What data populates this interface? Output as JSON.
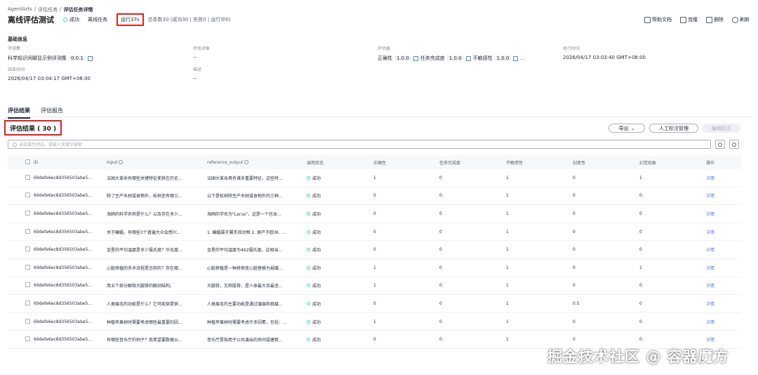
{
  "breadcrumb": [
    "AgentArts",
    "/",
    "评估任务",
    "/",
    "评估任务详情"
  ],
  "header": {
    "title": "离线评估测试",
    "status": "成功",
    "task_type": "离线任务",
    "run_time": "运行37s",
    "stats": "总条数30 (成功30 | 失败0 | 运行中0)",
    "actions": [
      {
        "label": "帮助文档",
        "icon": "book-icon"
      },
      {
        "label": "克隆",
        "icon": "copy-icon"
      },
      {
        "label": "删除",
        "icon": "trash-icon"
      },
      {
        "label": "刷新",
        "icon": "refresh-icon"
      }
    ]
  },
  "basic_info": {
    "section_title": "基础信息",
    "dataset_label": "评测集",
    "dataset_name": "科学知识闲聊显示例评测集",
    "dataset_version": "0.0.1",
    "target_label": "评估对象",
    "target_value": "--",
    "evaluator_label": "评估器",
    "evaluators": [
      {
        "name": "正确性",
        "version": "1.0.0"
      },
      {
        "name": "任务完成度",
        "version": "1.0.0"
      },
      {
        "name": "不敏感性",
        "version": "1.0.0"
      }
    ],
    "evaluator_more": "...",
    "exec_time_label": "执行时间",
    "exec_time": "2026/04/17 03:03:40 GMT+08:00",
    "end_time_label": "结束时间",
    "end_time": "2026/04/17 03:04:17 GMT+08:00",
    "desc_label": "描述",
    "desc_value": "--"
  },
  "tabs": [
    {
      "label": "评估结果",
      "active": true
    },
    {
      "label": "评估报告",
      "active": false
    }
  ],
  "results": {
    "title": "评估结果 ( 30 )",
    "export_label": "导出",
    "manual_label": "人工标注管理",
    "batch_label": "编辑标注",
    "search_placeholder": "选择属性筛选，或输入关键字搜索"
  },
  "table": {
    "columns": [
      "ID",
      "input",
      "reference_output",
      "调用状态",
      "正确性",
      "任务完成度",
      "不敏感性",
      "创意性",
      "幻觉现象",
      "操作"
    ],
    "rows": [
      {
        "id": "69defe6ec8d356503abe5...",
        "input": "法国大革命有哪些关键特征使其在历史...",
        "ref": "法国大革命具有诸多重要特征，这些特...",
        "status": "成功",
        "c1": "1",
        "c2": "0",
        "c3": "1",
        "c4": "0",
        "c5": "1",
        "op": "详情"
      },
      {
        "id": "69defe6ec8d356503abe5...",
        "input": "除了生产木材或食物外，松树还有哪三...",
        "ref": "以下是松树除生产木材或食物外的三种...",
        "status": "成功",
        "c1": "0",
        "c2": "0",
        "c3": "1",
        "c4": "0",
        "c5": "0",
        "op": "详情"
      },
      {
        "id": "69defe6ec8d356503abe5...",
        "input": "海鸥的科学名称是什么？以及存在多少...",
        "ref": "海鸥的学名为\"Larus\"，这是一个包含...",
        "status": "成功",
        "c1": "0",
        "c2": "0",
        "c3": "1",
        "c4": "0",
        "c5": "0",
        "op": "详情"
      },
      {
        "id": "69defe6ec8d356503abe5...",
        "input": "关于蝙蝠，有哪些3个普遍大众会感兴...",
        "ref": "1. 蝙蝠属于翼手目动物 2. 原产于欧洲、...",
        "status": "成功",
        "c1": "0",
        "c2": "0",
        "c3": "1",
        "c4": "0",
        "c5": "0",
        "op": "详情"
      },
      {
        "id": "69defe6ec8d356503abe5...",
        "input": "金星的平均温度是多少摄氏度？华氏度...",
        "ref": "金星的平均温度为462摄氏度。这相当...",
        "status": "成功",
        "c1": "0",
        "c2": "0",
        "c3": "1",
        "c4": "0",
        "c5": "0",
        "op": "详情"
      },
      {
        "id": "69defe6ec8d356503abe5...",
        "input": "心脏移植的手术流程是怎样的？存在哪...",
        "ref": "心脏移植是一种将病变心脏替换为捐赠...",
        "status": "成功",
        "c1": "1",
        "c2": "0",
        "c3": "1",
        "c4": "0",
        "c5": "1",
        "op": "详情"
      },
      {
        "id": "69defe6ec8d356503abe5...",
        "input": "用五个部分解释大腿骨的解剖结构。",
        "ref": "大腿骨，又称股骨，是人体最大且最坚...",
        "status": "成功",
        "c1": "1",
        "c2": "0",
        "c3": "1",
        "c4": "0",
        "c5": "0",
        "op": "详情"
      },
      {
        "id": "69defe6ec8d356503abe5...",
        "input": "人类眉毛的功能是什么？它可能穿提供...",
        "ref": "人类眉毛的主要功能是通过皱眉和挑眉...",
        "status": "成功",
        "c1": "0",
        "c2": "0",
        "c3": "1",
        "c4": "0.5",
        "c5": "0",
        "op": "详情"
      },
      {
        "id": "69defe6ec8d356503abe5...",
        "input": "种植苹果树时需要考虑哪些最重要的因...",
        "ref": "种植苹果树时需要考虑许多因素，包括：...",
        "status": "成功",
        "c1": "1",
        "c2": "0",
        "c3": "1",
        "c4": "0",
        "c5": "0",
        "op": "详情"
      },
      {
        "id": "69defe6ec8d356503abe5...",
        "input": "有哪些音乐厅的例子？我希望要数据以...",
        "ref": "音乐厅是指用于公共演出的房间或建筑...",
        "status": "成功",
        "c1": "0",
        "c2": "0",
        "c3": "1",
        "c4": "0",
        "c5": "0",
        "op": "详情"
      }
    ]
  },
  "watermark": "掘金技术社区 @ 容器魔方",
  "colors": {
    "success": "#50d4ab",
    "link": "#5e7ce0",
    "highlight": "#e02020"
  }
}
